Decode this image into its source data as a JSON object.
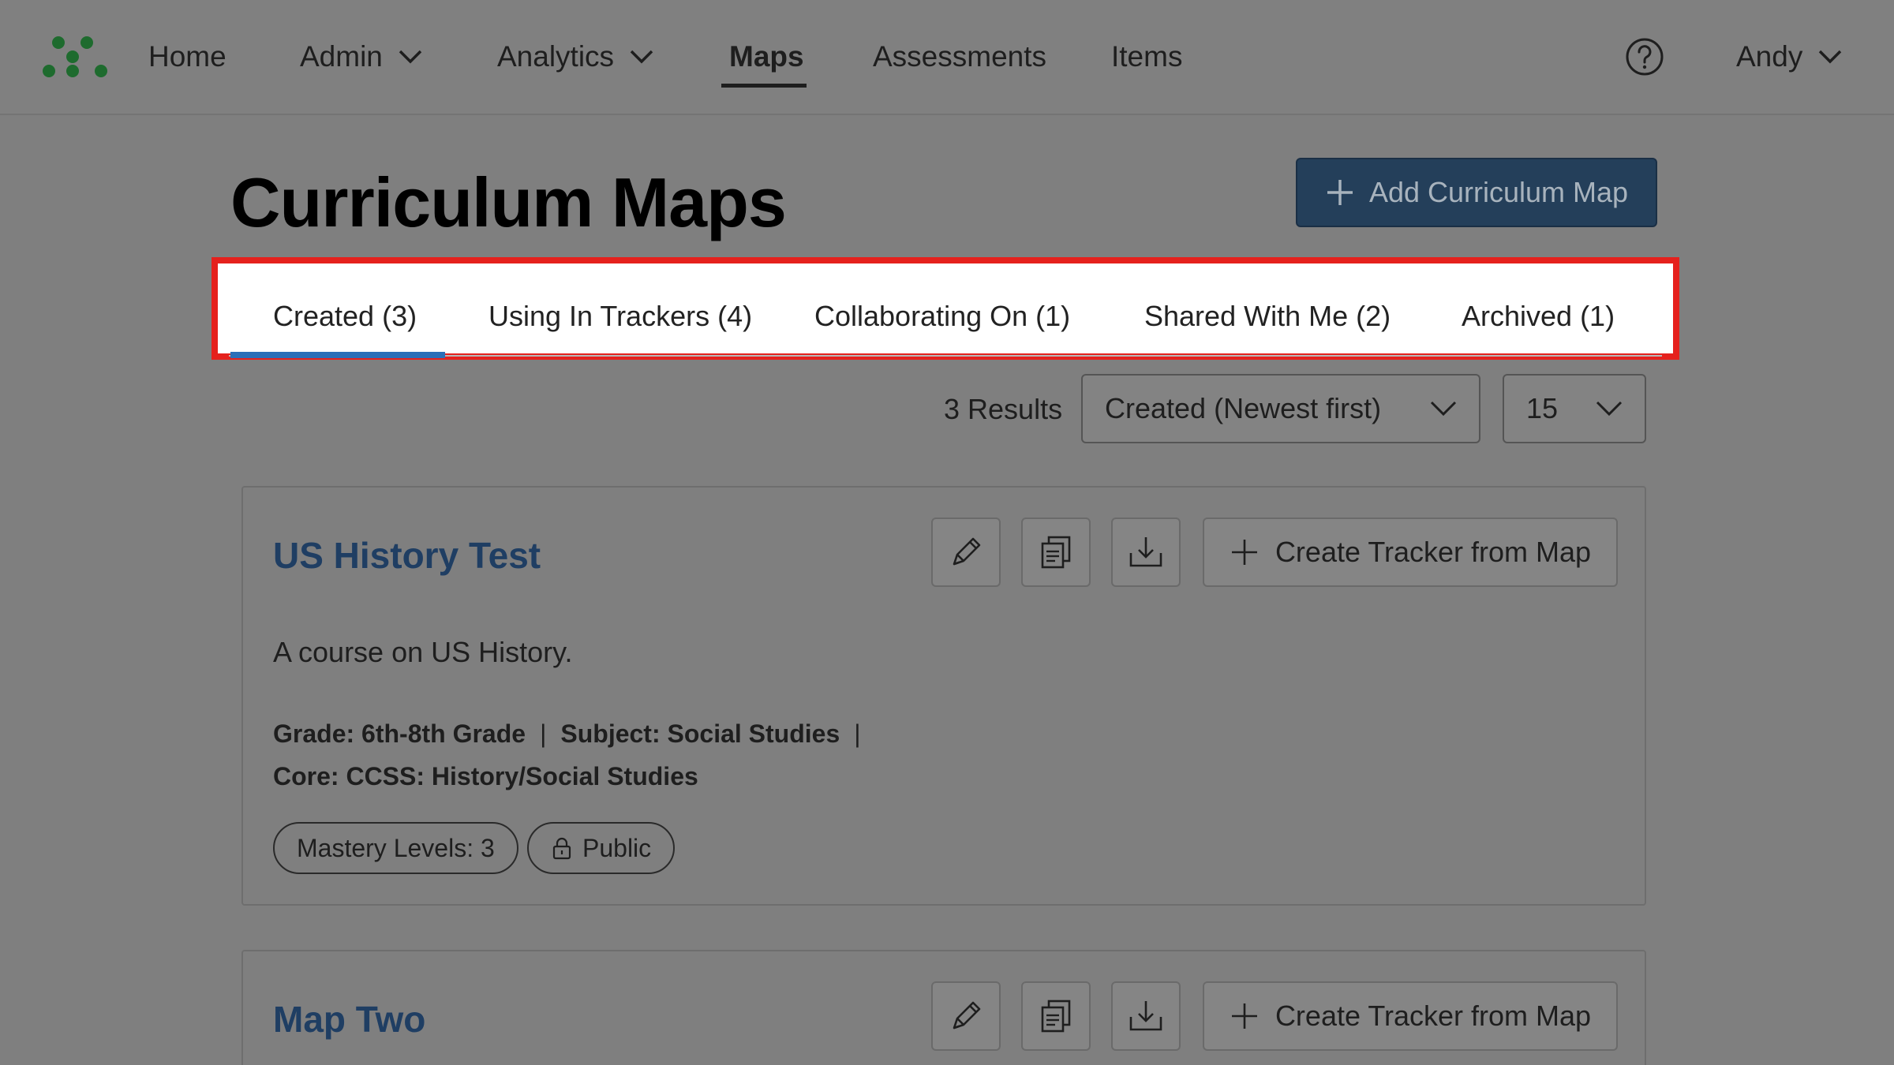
{
  "nav": {
    "items": [
      {
        "label": "Home"
      },
      {
        "label": "Admin"
      },
      {
        "label": "Analytics"
      },
      {
        "label": "Maps"
      },
      {
        "label": "Assessments"
      },
      {
        "label": "Items"
      }
    ],
    "active": "Maps",
    "user": "Andy",
    "icons": {
      "logo": "dots-logo-icon",
      "help": "help-circle-icon",
      "dropdown": "chevron-down-icon"
    }
  },
  "page": {
    "title": "Curriculum Maps",
    "add_button": "Add Curriculum Map"
  },
  "tabs": [
    {
      "label": "Created (3)"
    },
    {
      "label": "Using In Trackers (4)"
    },
    {
      "label": "Collaborating On (1)"
    },
    {
      "label": "Shared With Me (2)"
    },
    {
      "label": "Archived (1)"
    }
  ],
  "active_tab": "Created (3)",
  "results": {
    "count_text": "3 Results",
    "sort_value": "Created (Newest first)",
    "page_size": "15"
  },
  "maps": [
    {
      "title": "US History Test",
      "description": "A course on US History.",
      "grade": "Grade: 6th-8th Grade",
      "subject": "Subject: Social Studies",
      "core": "Core: CCSS: History/Social Studies",
      "mastery": "Mastery Levels: 3",
      "visibility": "Public",
      "tracker_button": "Create Tracker from Map"
    },
    {
      "title": "Map Two",
      "tracker_button": "Create Tracker from Map"
    }
  ],
  "separator": "|",
  "colors": {
    "accent_blue": "#2a6fb8",
    "highlight_red": "#e5211d",
    "logo_green": "#1e6b2e",
    "button_navy": "#243f5a",
    "link_navy": "#1f3e63"
  }
}
